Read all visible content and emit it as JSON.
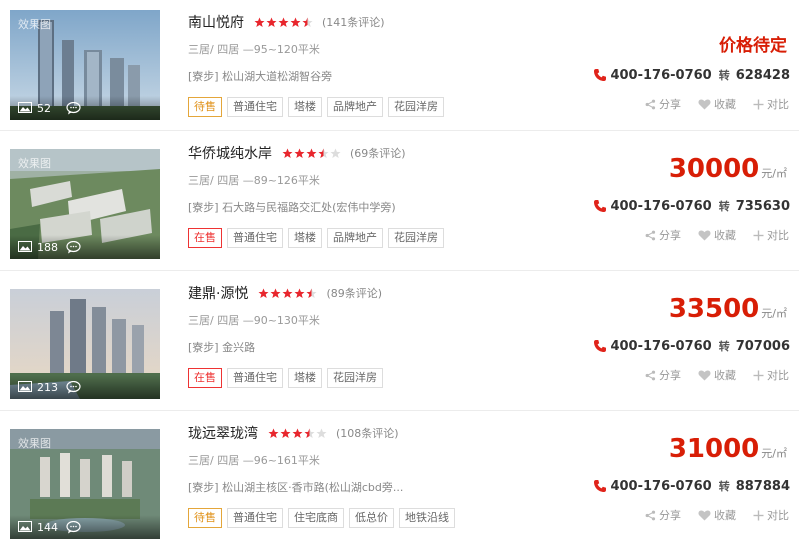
{
  "listings": [
    {
      "title": "南山悦府",
      "rating": 4.5,
      "reviews": "(141条评论)",
      "layout": "三居/ 四居 —95~120平米",
      "addr_tag": "[寮步]",
      "address": " 松山湖大道松湖智谷旁",
      "tags": [
        "待售",
        "普通住宅",
        "塔楼",
        "品牌地产",
        "花园洋房"
      ],
      "status_color": "orange",
      "price_text": "价格待定",
      "price_num": "",
      "price_unit": "",
      "phone": "400-176-0760",
      "zhuan": "转",
      "ext": "628428",
      "image_tag": "效果图",
      "image_count": "52",
      "share": "分享",
      "fav": "收藏",
      "compare": "对比"
    },
    {
      "title": "华侨城纯水岸",
      "rating": 3.5,
      "reviews": "(69条评论)",
      "layout": "三居/ 四居 —89~126平米",
      "addr_tag": "[寮步]",
      "address": " 石大路与民福路交汇处(宏伟中学旁)",
      "tags": [
        "在售",
        "普通住宅",
        "塔楼",
        "品牌地产",
        "花园洋房"
      ],
      "status_color": "red",
      "price_text": "",
      "price_num": "30000",
      "price_unit": "元/㎡",
      "phone": "400-176-0760",
      "zhuan": "转",
      "ext": "735630",
      "image_tag": "效果图",
      "image_count": "188",
      "share": "分享",
      "fav": "收藏",
      "compare": "对比"
    },
    {
      "title": "建鼎·源悦",
      "rating": 4.5,
      "reviews": "(89条评论)",
      "layout": "三居/ 四居 —90~130平米",
      "addr_tag": "[寮步]",
      "address": " 金兴路",
      "tags": [
        "在售",
        "普通住宅",
        "塔楼",
        "花园洋房"
      ],
      "status_color": "red",
      "price_text": "",
      "price_num": "33500",
      "price_unit": "元/㎡",
      "phone": "400-176-0760",
      "zhuan": "转",
      "ext": "707006",
      "image_tag": "",
      "image_count": "213",
      "share": "分享",
      "fav": "收藏",
      "compare": "对比"
    },
    {
      "title": "珑远翠珑湾",
      "rating": 3.5,
      "reviews": "(108条评论)",
      "layout": "三居/ 四居 —96~161平米",
      "addr_tag": "[寮步]",
      "address": " 松山湖主核区·香市路(松山湖cbd旁...",
      "tags": [
        "待售",
        "普通住宅",
        "住宅底商",
        "低总价",
        "地铁沿线"
      ],
      "status_color": "orange",
      "price_text": "",
      "price_num": "31000",
      "price_unit": "元/㎡",
      "phone": "400-176-0760",
      "zhuan": "转",
      "ext": "887884",
      "image_tag": "效果图",
      "image_count": "144",
      "share": "分享",
      "fav": "收藏",
      "compare": "对比"
    }
  ],
  "colors": {
    "price_red": "#d81e06",
    "star_red": "#e8262d",
    "star_empty": "#dddddd",
    "status_orange": "#e0921a",
    "status_red": "#ee3333"
  },
  "icons": {
    "image": "picture-icon",
    "comment": "comment-icon",
    "phone": "phone-icon",
    "share": "share-icon",
    "fav": "heart-icon",
    "compare": "plus-icon"
  }
}
